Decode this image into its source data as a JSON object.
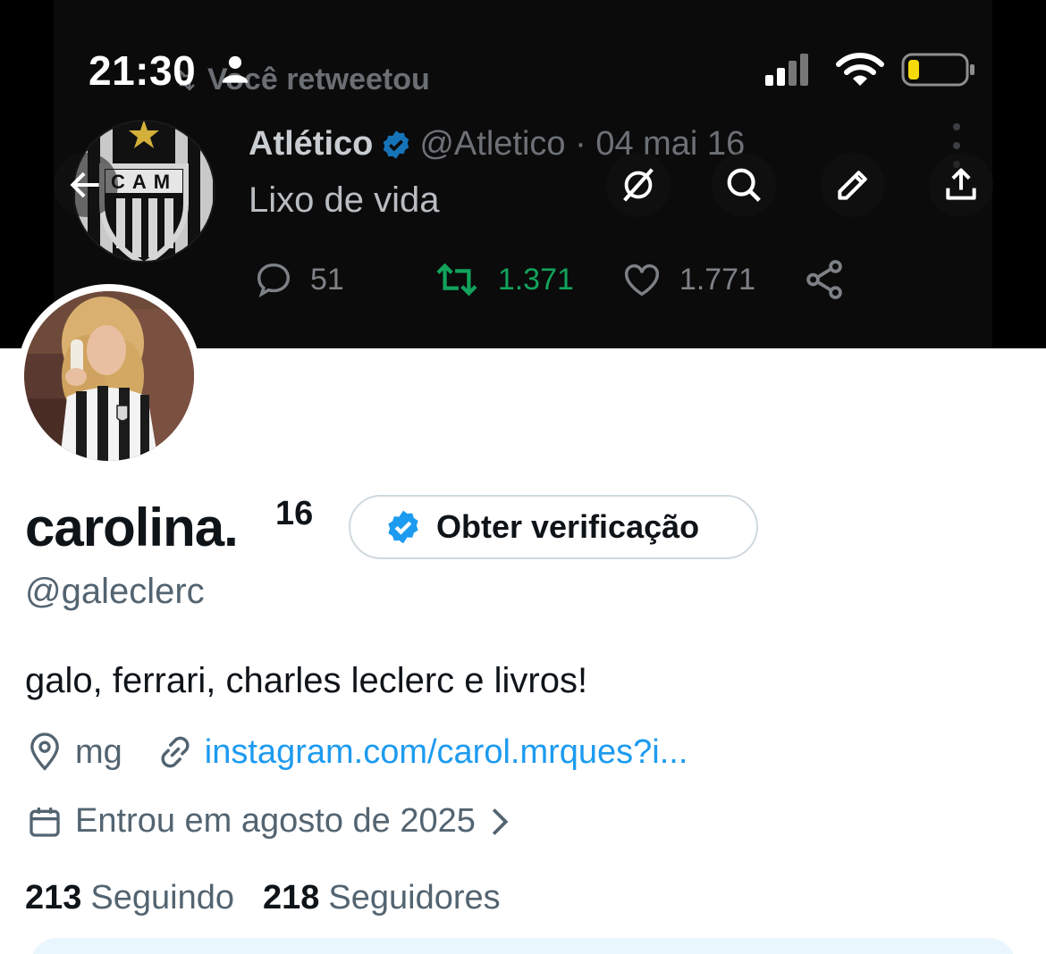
{
  "status_bar": {
    "time": "21:30"
  },
  "banner": {
    "retweet_label": "Você retweetou",
    "tweet": {
      "name": "Atlético",
      "handle_date": "@Atletico · 04 mai 16",
      "text": "Lixo de vida",
      "replies": "51",
      "retweets": "1.371",
      "likes": "1.771"
    },
    "crest_text": "CAM"
  },
  "profile": {
    "name": "carolina.",
    "name_sup": "16",
    "verify_button_label": "Obter verificação",
    "handle": "@galeclerc",
    "bio": "galo, ferrari, charles leclerc e livros!",
    "location": "mg",
    "link": "instagram.com/carol.mrques?i...",
    "joined": "Entrou em agosto de 2025",
    "following_count": "213",
    "following_label": "Seguindo",
    "followers_count": "218",
    "followers_label": "Seguidores"
  },
  "colors": {
    "accent": "#1d9bf0",
    "secondary_text": "#536471",
    "retweet_green": "#12a35c",
    "battery_yellow": "#f5d90a"
  },
  "icons": [
    "back-arrow-icon",
    "grok-icon",
    "search-icon",
    "edit-icon",
    "share-icon",
    "location-icon",
    "link-icon",
    "calendar-icon",
    "chevron-right-icon",
    "verified-badge-icon"
  ]
}
